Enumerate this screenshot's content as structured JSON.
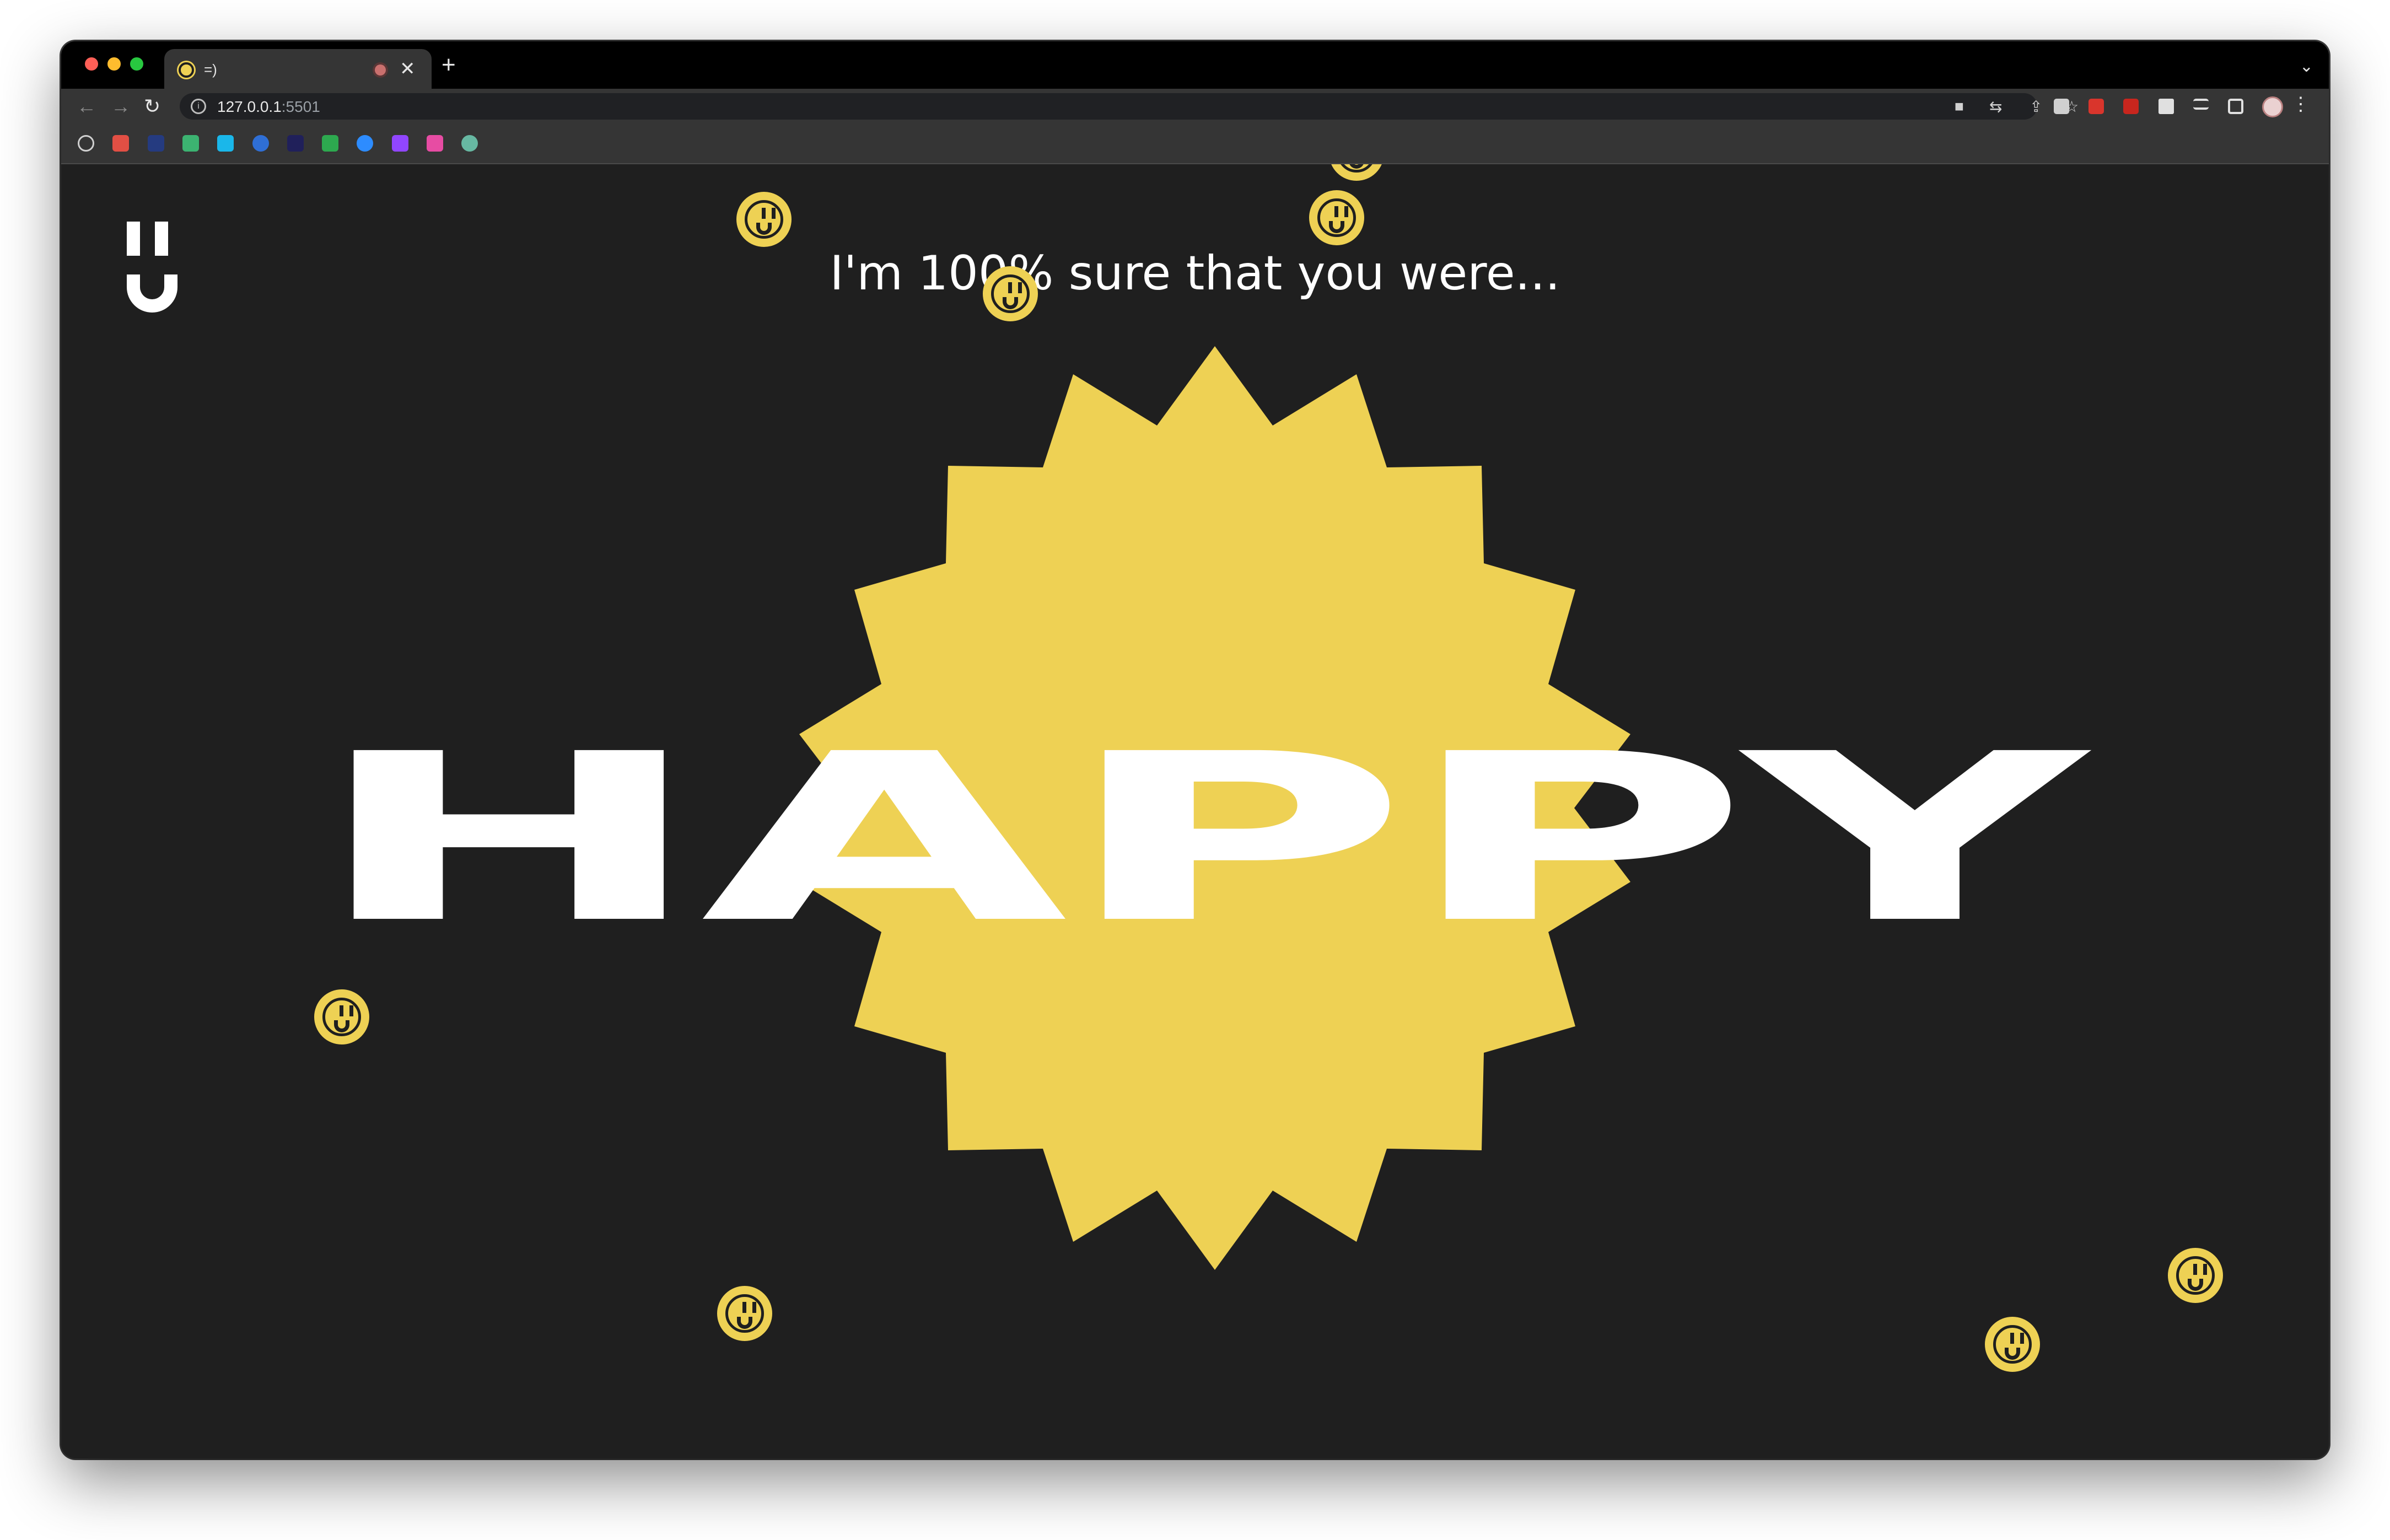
{
  "browser": {
    "tab": {
      "title": "=)",
      "close_glyph": "✕"
    },
    "new_tab_glyph": "+",
    "tab_search_glyph": "⌄",
    "nav": {
      "back_glyph": "←",
      "forward_glyph": "→",
      "reload_glyph": "↻"
    },
    "address": {
      "host": "127.0.0.1",
      "port": ":5501"
    },
    "omnibox_icons": [
      "camera-icon",
      "translate-icon",
      "share-icon",
      "star-icon"
    ],
    "extension_icons": [
      "extension-1-icon",
      "extension-2-icon",
      "acrobat-icon",
      "puzzle-icon",
      "reading-list-icon",
      "side-panel-icon",
      "profile-avatar",
      "menu-icon"
    ],
    "bookmarks": [
      "history-icon",
      "gmail-icon",
      "paypal-icon",
      "bookmark-v-icon",
      "vimeo-icon",
      "play-icon",
      "bookmark-dark-icon",
      "drive-icon",
      "zoom-icon",
      "twitch-icon",
      "bookmark-pink-icon",
      "bookmark-teal-icon"
    ]
  },
  "page": {
    "headline": "I'm 100% sure that you were...",
    "word": "HAPPY",
    "colors": {
      "background": "#1f1f1f",
      "accent": "#eed154",
      "text": "#ffffff"
    },
    "logo_icon": "smiley-logo-icon",
    "floating_icon": "smiley-face-icon"
  }
}
